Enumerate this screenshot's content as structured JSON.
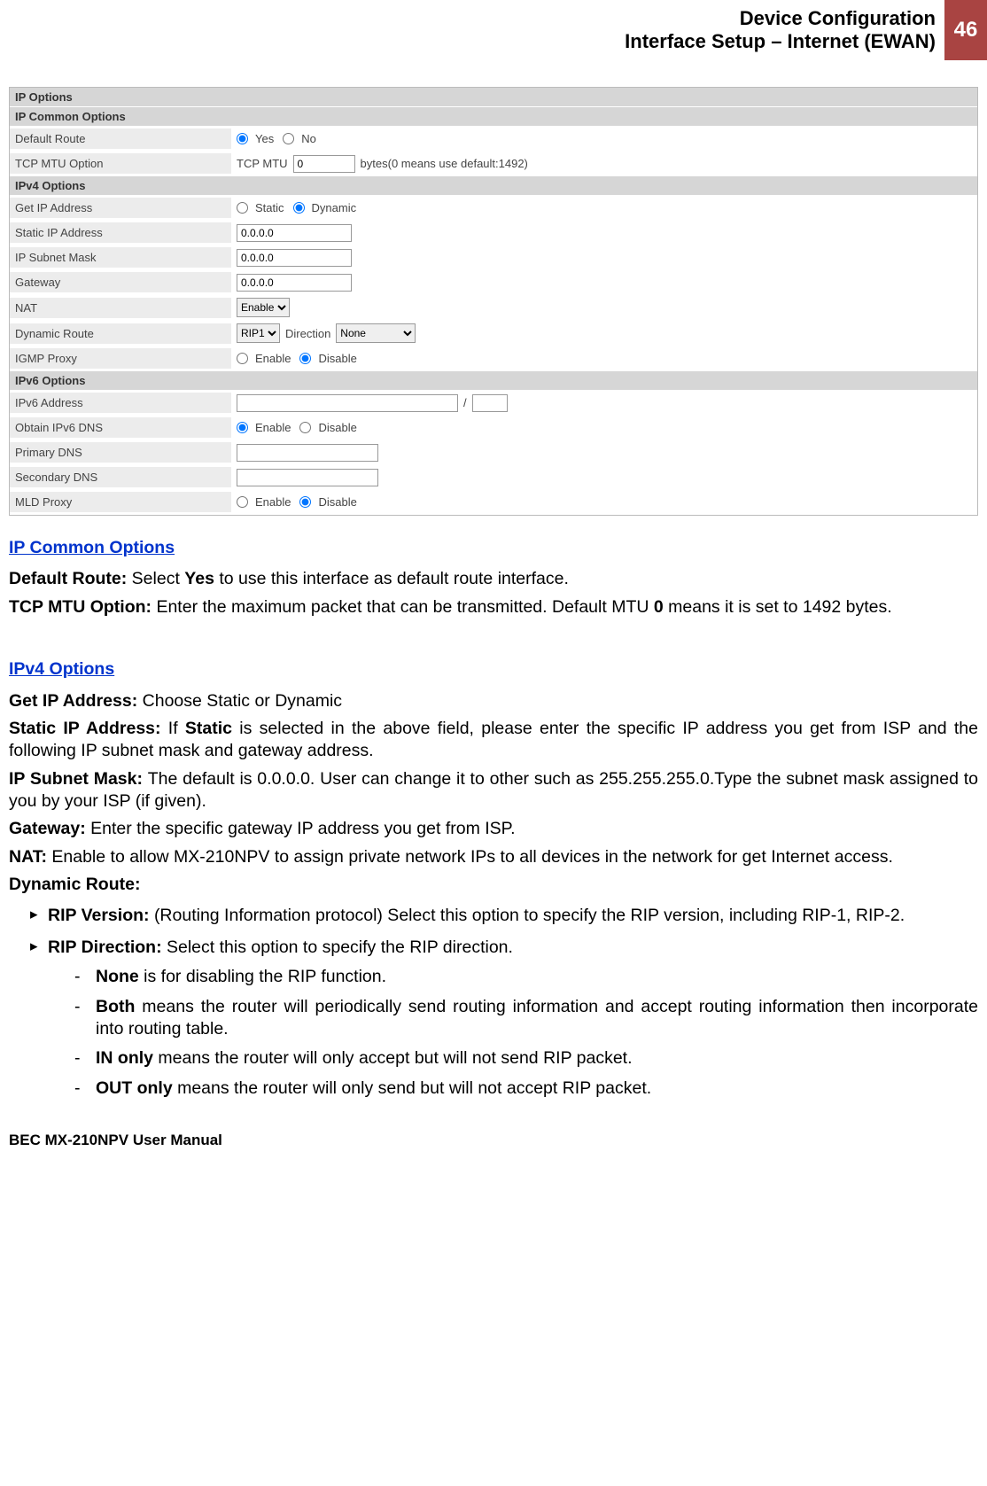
{
  "header": {
    "title1": "Device Configuration",
    "title2": "Interface Setup – Internet (EWAN)",
    "page_number": "46"
  },
  "screenshot": {
    "sections": {
      "ip_options": "IP Options",
      "ip_common": "IP Common Options",
      "ipv4": "IPv4 Options",
      "ipv6": "IPv6 Options"
    },
    "ip_common": {
      "default_route": {
        "label": "Default Route",
        "yes": "Yes",
        "no": "No"
      },
      "tcp_mtu": {
        "label": "TCP MTU Option",
        "prefix": "TCP MTU",
        "value": "0",
        "suffix": "bytes(0 means use default:1492)"
      }
    },
    "ipv4": {
      "get_ip": {
        "label": "Get IP Address",
        "static": "Static",
        "dynamic": "Dynamic"
      },
      "static_ip": {
        "label": "Static IP Address",
        "value": "0.0.0.0"
      },
      "subnet": {
        "label": "IP Subnet Mask",
        "value": "0.0.0.0"
      },
      "gateway": {
        "label": "Gateway",
        "value": "0.0.0.0"
      },
      "nat": {
        "label": "NAT",
        "value": "Enable"
      },
      "dynroute": {
        "label": "Dynamic Route",
        "rip": "RIP1",
        "dir_label": "Direction",
        "dir": "None"
      },
      "igmp": {
        "label": "IGMP Proxy",
        "enable": "Enable",
        "disable": "Disable"
      }
    },
    "ipv6": {
      "addr": {
        "label": "IPv6 Address",
        "value1": "",
        "slash": "/",
        "value2": ""
      },
      "obtain_dns": {
        "label": "Obtain IPv6 DNS",
        "enable": "Enable",
        "disable": "Disable"
      },
      "primary_dns": {
        "label": "Primary DNS",
        "value": ""
      },
      "secondary_dns": {
        "label": "Secondary DNS",
        "value": ""
      },
      "mld": {
        "label": "MLD Proxy",
        "enable": "Enable",
        "disable": "Disable"
      }
    }
  },
  "sections": {
    "ip_common_title": "IP Common Options",
    "ipv4_title": "IPv4 Options"
  },
  "paras": {
    "default_route_1": "Default Route: ",
    "default_route_2": "Select ",
    "default_route_3": "Yes",
    "default_route_4": " to use this interface as default route interface.",
    "tcp_mtu_1": "TCP MTU Option: ",
    "tcp_mtu_2": "Enter the maximum packet that can be transmitted.  Default MTU ",
    "tcp_mtu_3": "0",
    "tcp_mtu_4": " means it is set to 1492 bytes.",
    "get_ip_1": "Get IP Address: ",
    "get_ip_2": "Choose Static or Dynamic",
    "static_ip_1": "Static IP Address: ",
    "static_ip_2a": "If ",
    "static_ip_2b": "Static",
    "static_ip_2c": " is selected in the above field, please enter the specific IP address you get from ISP and the following IP subnet mask and gateway address.",
    "subnet_1": "IP Subnet Mask: ",
    "subnet_2": "The default is 0.0.0.0. User can change it to other such as 255.255.255.0.Type the subnet mask assigned to you by your ISP (if given).",
    "gateway_1": "Gateway: ",
    "gateway_2": "Enter the specific gateway IP address you get from ISP.",
    "nat_1": "NAT:  ",
    "nat_2": "Enable to allow MX-210NPV to assign private network IPs to all devices in the network for get Internet access.",
    "dynroute": "Dynamic Route:",
    "rip_ver_1": "RIP Version: ",
    "rip_ver_2": "(Routing Information protocol) Select this option to specify the RIP version, including RIP-1, RIP-2.",
    "rip_dir_1": "RIP Direction: ",
    "rip_dir_2": "Select this option to specify the RIP direction.",
    "none_1": "None",
    "none_2": " is for disabling the RIP function.",
    "both_1": "Both",
    "both_2": " means the router will periodically send routing information and accept routing information then   incorporate into routing table.",
    "inonly_1": "IN only",
    "inonly_2": " means the router will only accept but will not send RIP packet.",
    "outonly_1": "OUT only",
    "outonly_2": " means the router will only send but will not accept RIP packet."
  },
  "footer": "BEC MX-210NPV User Manual"
}
